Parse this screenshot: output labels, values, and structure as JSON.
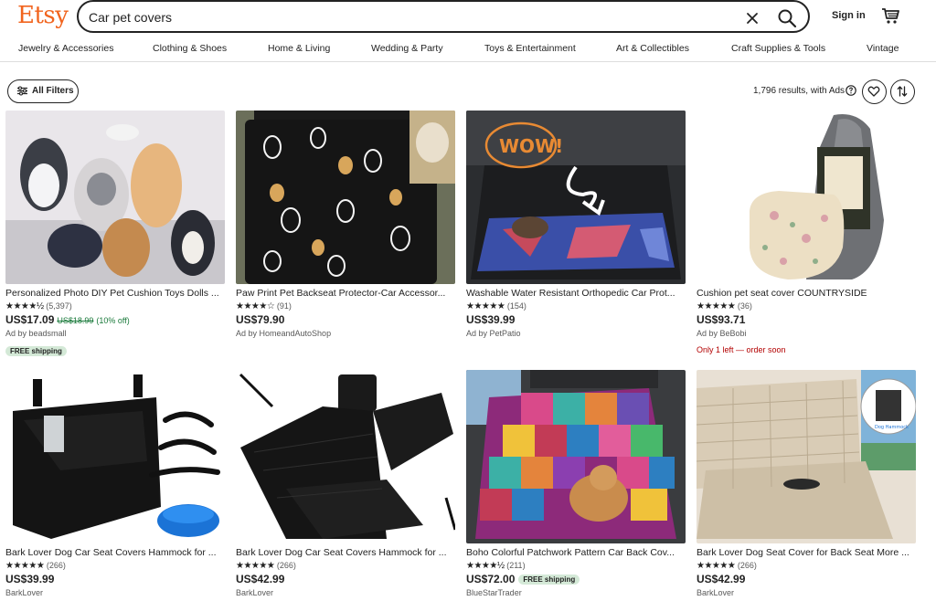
{
  "header": {
    "logo": "Etsy",
    "search_value": "Car pet covers",
    "signin": "Sign in"
  },
  "categories": [
    "Jewelry & Accessories",
    "Clothing & Shoes",
    "Home & Living",
    "Wedding & Party",
    "Toys & Entertainment",
    "Art & Collectibles",
    "Craft Supplies & Tools",
    "Vintage"
  ],
  "toolbar": {
    "filters_label": "All Filters",
    "results_text": "1,796 results, with Ads"
  },
  "listings": [
    {
      "title": "Personalized Photo DIY Pet Cushion Toys Dolls ...",
      "stars": "★★★★½",
      "reviews": "(5,397)",
      "price": "US$17.09",
      "original_price": "US$18.99",
      "discount": "(10% off)",
      "shop": "Ad by beadsmall",
      "badge": "FREE shipping",
      "urgency": ""
    },
    {
      "title": "Paw Print Pet Backseat Protector-Car Accessor...",
      "stars": "★★★★☆",
      "reviews": "(91)",
      "price": "US$79.90",
      "original_price": "",
      "discount": "",
      "shop": "Ad by HomeandAutoShop",
      "badge": "",
      "urgency": ""
    },
    {
      "title": "Washable Water Resistant Orthopedic Car Prot...",
      "stars": "★★★★★",
      "reviews": "(154)",
      "price": "US$39.99",
      "original_price": "",
      "discount": "",
      "shop": "Ad by PetPatio",
      "badge": "",
      "urgency": ""
    },
    {
      "title": "Cushion pet seat cover COUNTRYSIDE",
      "stars": "★★★★★",
      "reviews": "(36)",
      "price": "US$93.71",
      "original_price": "",
      "discount": "",
      "shop": "Ad by BeBobi",
      "badge": "",
      "urgency": "Only 1 left — order soon"
    },
    {
      "title": "Bark Lover Dog Car Seat Covers Hammock for ...",
      "stars": "★★★★★",
      "reviews": "(266)",
      "price": "US$39.99",
      "original_price": "",
      "discount": "",
      "shop": "BarkLover",
      "badge": "",
      "urgency": ""
    },
    {
      "title": "Bark Lover Dog Car Seat Covers Hammock for ...",
      "stars": "★★★★★",
      "reviews": "(266)",
      "price": "US$42.99",
      "original_price": "",
      "discount": "",
      "shop": "BarkLover",
      "badge": "",
      "urgency": ""
    },
    {
      "title": "Boho Colorful Patchwork Pattern Car Back Cov...",
      "stars": "★★★★½",
      "reviews": "(211)",
      "price": "US$72.00",
      "original_price": "",
      "discount": "",
      "shop": "BlueStarTrader",
      "badge": "FREE shipping",
      "urgency": ""
    },
    {
      "title": "Bark Lover Dog Seat Cover for Back Seat More ...",
      "stars": "★★★★★",
      "reviews": "(266)",
      "price": "US$42.99",
      "original_price": "",
      "discount": "",
      "shop": "BarkLover",
      "badge": "",
      "urgency": ""
    }
  ],
  "image_overlays": {
    "wow": "WOW!",
    "dog_hammock": "Dog Hammock"
  },
  "colors": {
    "brand": "#f1641e",
    "sale_green": "#1a7a3b",
    "badge_bg": "#d4e9d7",
    "urgency_red": "#b30000"
  }
}
